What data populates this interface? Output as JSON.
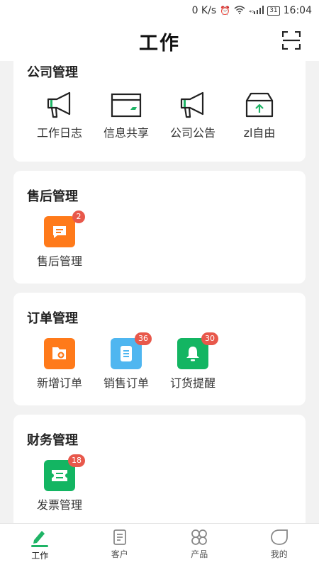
{
  "status_bar": {
    "speed": "0 K/s",
    "signal": "⁴ᴳ",
    "battery": "31",
    "time": "16:04"
  },
  "header": {
    "title": "工作"
  },
  "sections": [
    {
      "title": "公司管理",
      "items": [
        {
          "label": "工作日志"
        },
        {
          "label": "信息共享"
        },
        {
          "label": "公司公告"
        },
        {
          "label": "zl自由"
        }
      ]
    },
    {
      "title": "售后管理",
      "items": [
        {
          "label": "售后管理",
          "badge": "2"
        }
      ]
    },
    {
      "title": "订单管理",
      "items": [
        {
          "label": "新增订单"
        },
        {
          "label": "销售订单",
          "badge": "36"
        },
        {
          "label": "订货提醒",
          "badge": "30"
        }
      ]
    },
    {
      "title": "财务管理",
      "items": [
        {
          "label": "发票管理",
          "badge": "18"
        }
      ]
    }
  ],
  "tabs": [
    {
      "label": "工作"
    },
    {
      "label": "客户"
    },
    {
      "label": "产品"
    },
    {
      "label": "我的"
    }
  ],
  "colors": {
    "accent": "#1fb466",
    "orange": "#ff7a1a",
    "blue": "#4fb6f0",
    "green": "#13b562",
    "badge": "#e8584b"
  }
}
